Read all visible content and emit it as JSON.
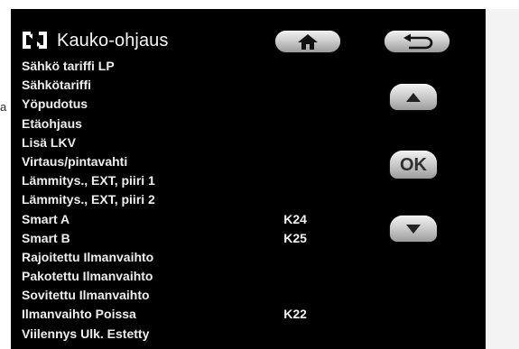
{
  "header": {
    "title": "Kauko-ohjaus",
    "title_icon": "remote-control-icon"
  },
  "buttons": {
    "home_icon": "home-icon",
    "back_icon": "back-arrow-icon",
    "up_icon": "up-arrow-icon",
    "ok_label": "OK",
    "down_icon": "down-arrow-icon"
  },
  "menu": {
    "items": [
      {
        "label": "Sähkö tariffi LP",
        "value": ""
      },
      {
        "label": "Sähkötariffi",
        "value": ""
      },
      {
        "label": "Yöpudotus",
        "value": ""
      },
      {
        "label": "Etäohjaus",
        "value": ""
      },
      {
        "label": "Lisä LKV",
        "value": ""
      },
      {
        "label": "Virtaus/pintavahti",
        "value": ""
      },
      {
        "label": "Lämmitys., EXT, piiri 1",
        "value": ""
      },
      {
        "label": "Lämmitys., EXT, piiri 2",
        "value": ""
      },
      {
        "label": "Smart A",
        "value": "K24"
      },
      {
        "label": "Smart B",
        "value": "K25"
      },
      {
        "label": "Rajoitettu Ilmanvaihto",
        "value": ""
      },
      {
        "label": "Pakotettu Ilmanvaihto",
        "value": ""
      },
      {
        "label": "Sovitettu Ilmanvaihto",
        "value": ""
      },
      {
        "label": "Ilmanvaihto Poissa",
        "value": "K22"
      },
      {
        "label": "Viilennys Ulk. Estetty",
        "value": ""
      }
    ]
  },
  "colors": {
    "screen_background": "#000000",
    "text": "#eeeeee",
    "button_light": "#f1f1f1",
    "button_dark": "#9c9c9c"
  }
}
